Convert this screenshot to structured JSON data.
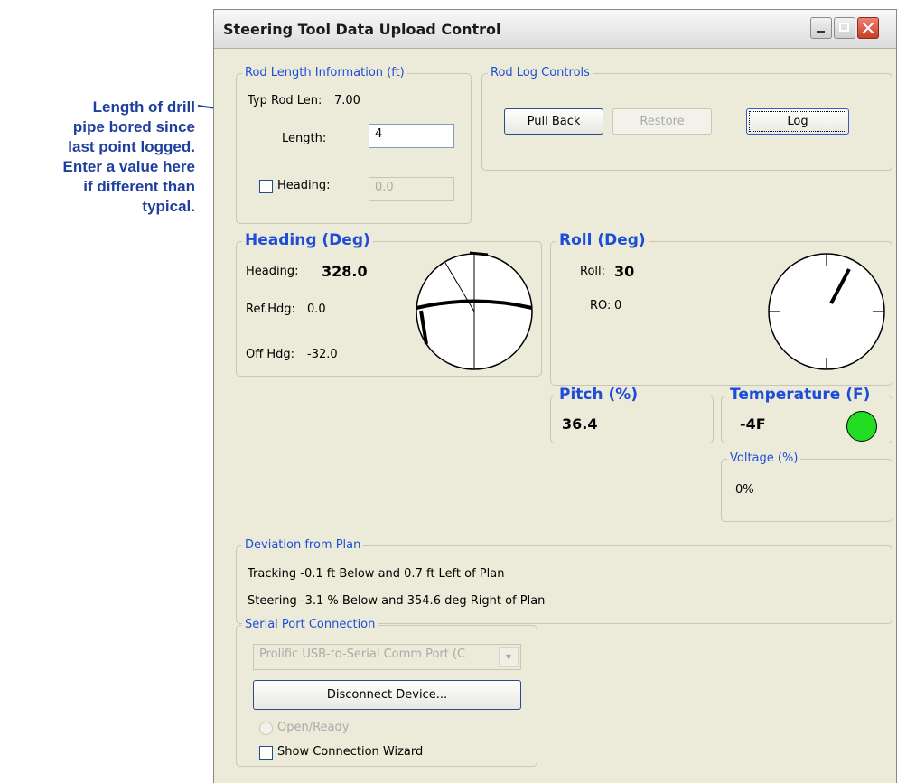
{
  "callout": {
    "lines": [
      "Length of drill",
      "pipe bored since",
      "last point logged.",
      "Enter a value here",
      "if different than",
      "typical."
    ]
  },
  "window": {
    "title": "Steering Tool Data Upload Control"
  },
  "rod_length": {
    "legend": "Rod Length Information (ft)",
    "typ_label": "Typ Rod Len:",
    "typ_value": "7.00",
    "length_label": "Length:",
    "length_value": "4",
    "heading_label": "Heading:",
    "heading_value": "0.0",
    "heading_checked": false
  },
  "rod_log": {
    "legend": "Rod Log Controls",
    "pull_back": "Pull Back",
    "restore": "Restore",
    "log": "Log"
  },
  "heading_panel": {
    "legend": "Heading (Deg)",
    "heading_label": "Heading:",
    "heading_value": "328.0",
    "ref_label": "Ref.Hdg:",
    "ref_value": "0.0",
    "off_label": "Off Hdg:",
    "off_value": "-32.0"
  },
  "roll_panel": {
    "legend": "Roll (Deg)",
    "roll_label": "Roll:",
    "roll_value": "30",
    "ro_label": "RO:",
    "ro_value": "0"
  },
  "pitch": {
    "legend": "Pitch (%)",
    "value": "36.4"
  },
  "temperature": {
    "legend": "Temperature (F)",
    "value": "-4F",
    "indicator_color": "#22dd22"
  },
  "voltage": {
    "legend": "Voltage (%)",
    "value": "0%"
  },
  "deviation": {
    "legend": "Deviation from Plan",
    "tracking": "Tracking -0.1 ft Below and 0.7 ft Left of Plan",
    "steering": "Steering -3.1 % Below and 354.6 deg Right of Plan"
  },
  "serial": {
    "legend": "Serial Port Connection",
    "port": "Prolific USB-to-Serial Comm Port (C",
    "disconnect": "Disconnect Device...",
    "open_ready": "Open/Ready",
    "show_wizard": "Show Connection Wizard",
    "show_wizard_checked": false
  },
  "colors": {
    "legend_blue": "#1e4ed8",
    "callout_blue": "#1f3f9f",
    "window_bg": "#ecead8"
  }
}
